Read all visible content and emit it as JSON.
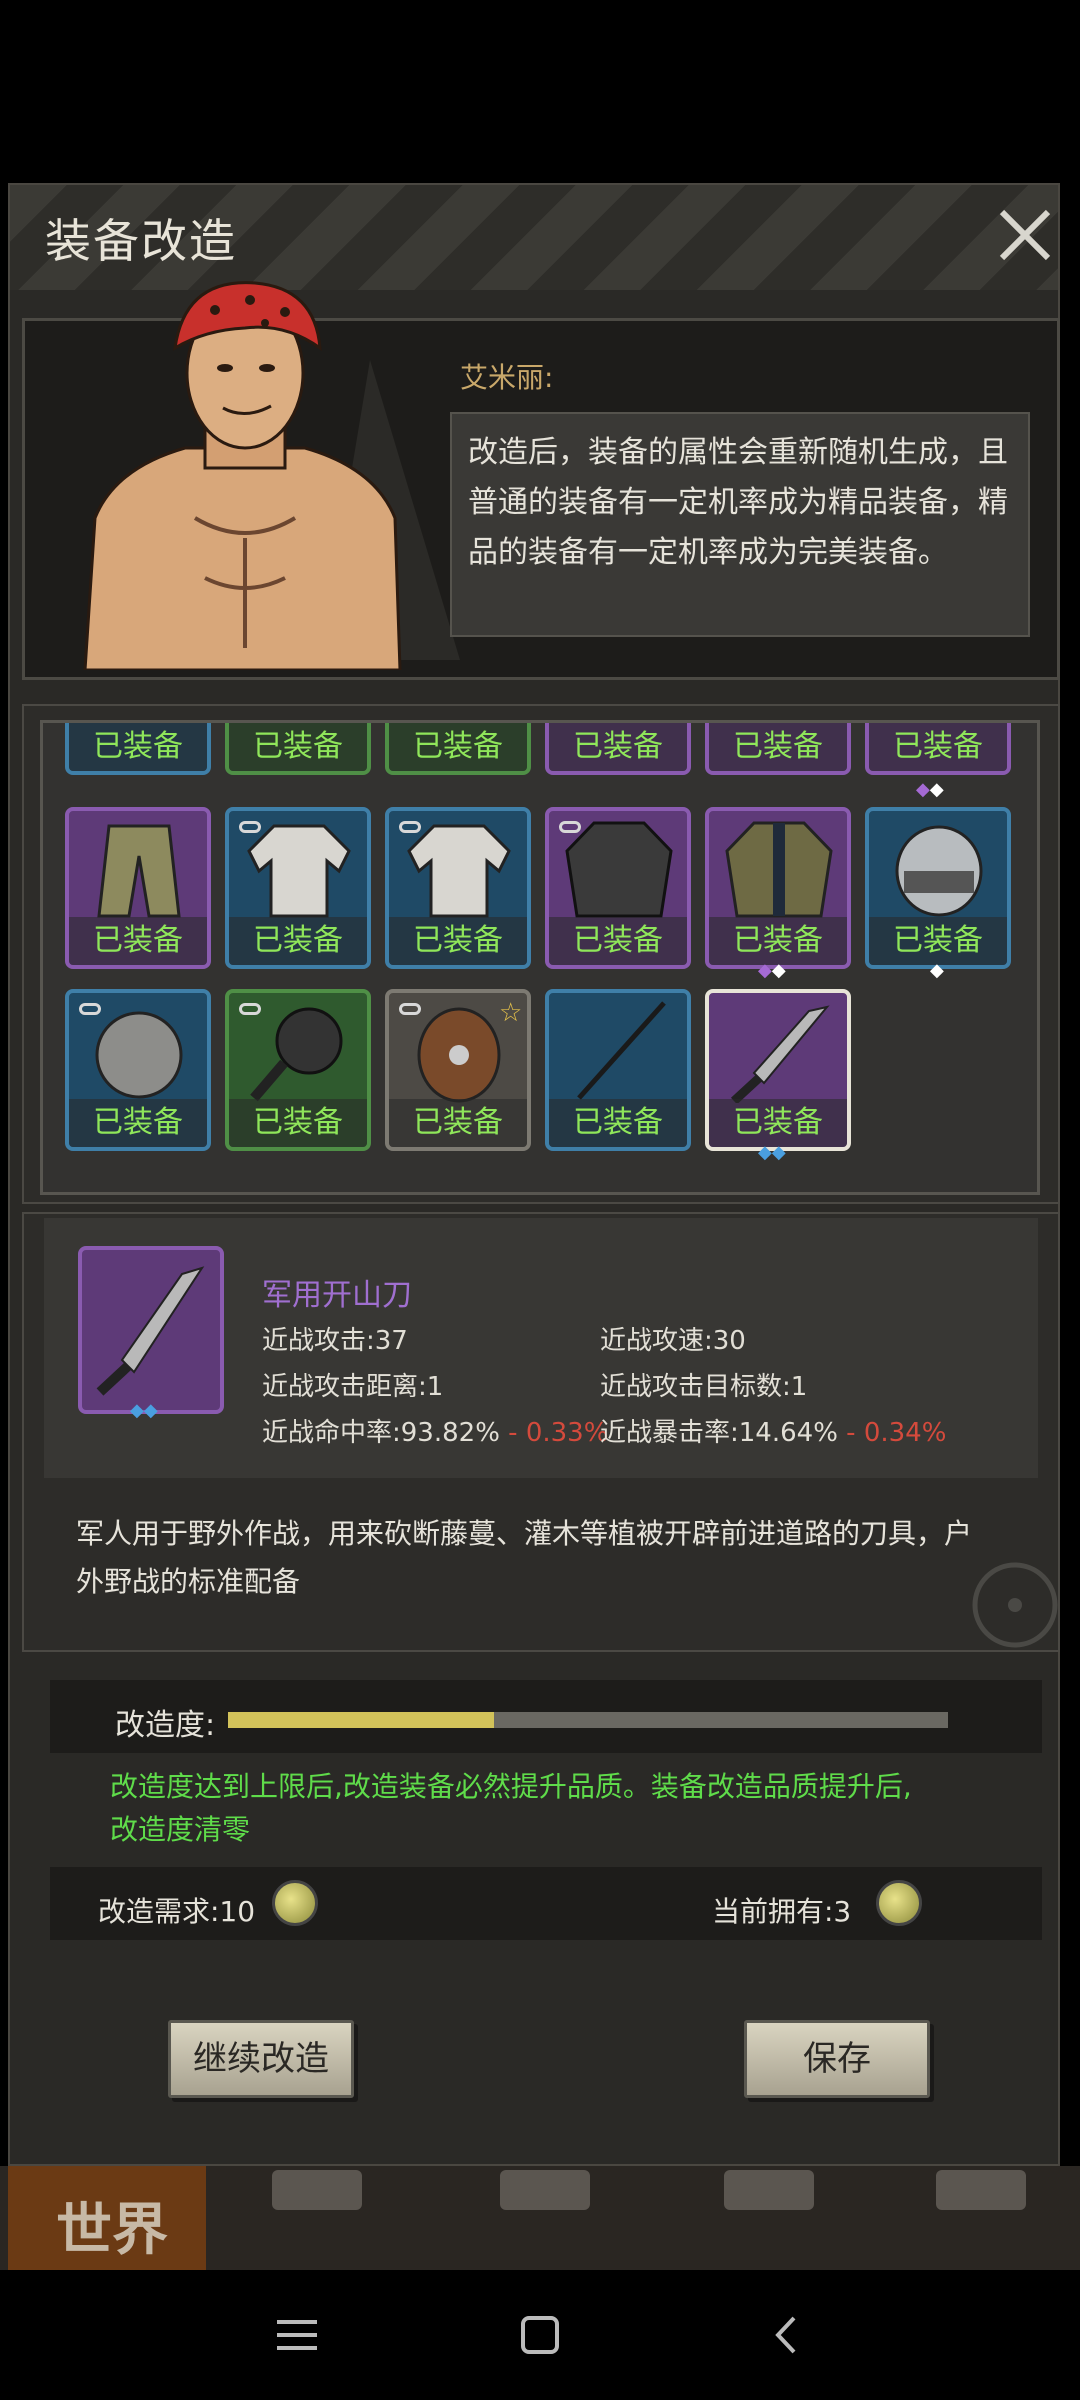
{
  "dialog_title": "装备改造",
  "npc": {
    "name": "艾米丽:",
    "text": "改造后，装备的属性会重新随机生成，且普通的装备有一定机率成为精品装备，精品的装备有一定机率成为完美装备。"
  },
  "equipped_label": "已装备",
  "inventory": {
    "row0": [
      "blue",
      "green",
      "green",
      "purple",
      "purple",
      "purple"
    ],
    "row1": [
      "purple",
      "blue",
      "blue",
      "purple",
      "purple",
      "blue"
    ],
    "row2": [
      "blue",
      "green",
      "gray",
      "blue",
      "purple"
    ]
  },
  "item": {
    "name": "军用开山刀",
    "stats": [
      {
        "label": "近战攻击:37"
      },
      {
        "label": "近战攻速:30"
      },
      {
        "label": "近战攻击距离:1"
      },
      {
        "label": "近战攻击目标数:1"
      },
      {
        "label": "近战命中率:93.82%",
        "delta": "- 0.33%"
      },
      {
        "label": "近战暴击率:14.64%",
        "delta": "- 0.34%"
      }
    ],
    "description": "军人用于野外作战，用来砍断藤蔓、灌木等植被开辟前进道路的刀具，户外野战的标准配备"
  },
  "progress": {
    "label": "改造度:",
    "fraction": 0.37,
    "hint": "改造度达到上限后,改造装备必然提升品质。装备改造品质提升后,改造度清零"
  },
  "requirement": {
    "need_label": "改造需求:10",
    "own_label": "当前拥有:3"
  },
  "buttons": {
    "continue": "继续改造",
    "save": "保存"
  },
  "bottom_nav": {
    "world": "世界"
  },
  "colors": {
    "equipped_text": "#8fe65a",
    "item_name": "#a06fd0",
    "negative": "#d44a3c",
    "hint": "#5fdc4a",
    "progress_fill": "#d2c25a"
  }
}
